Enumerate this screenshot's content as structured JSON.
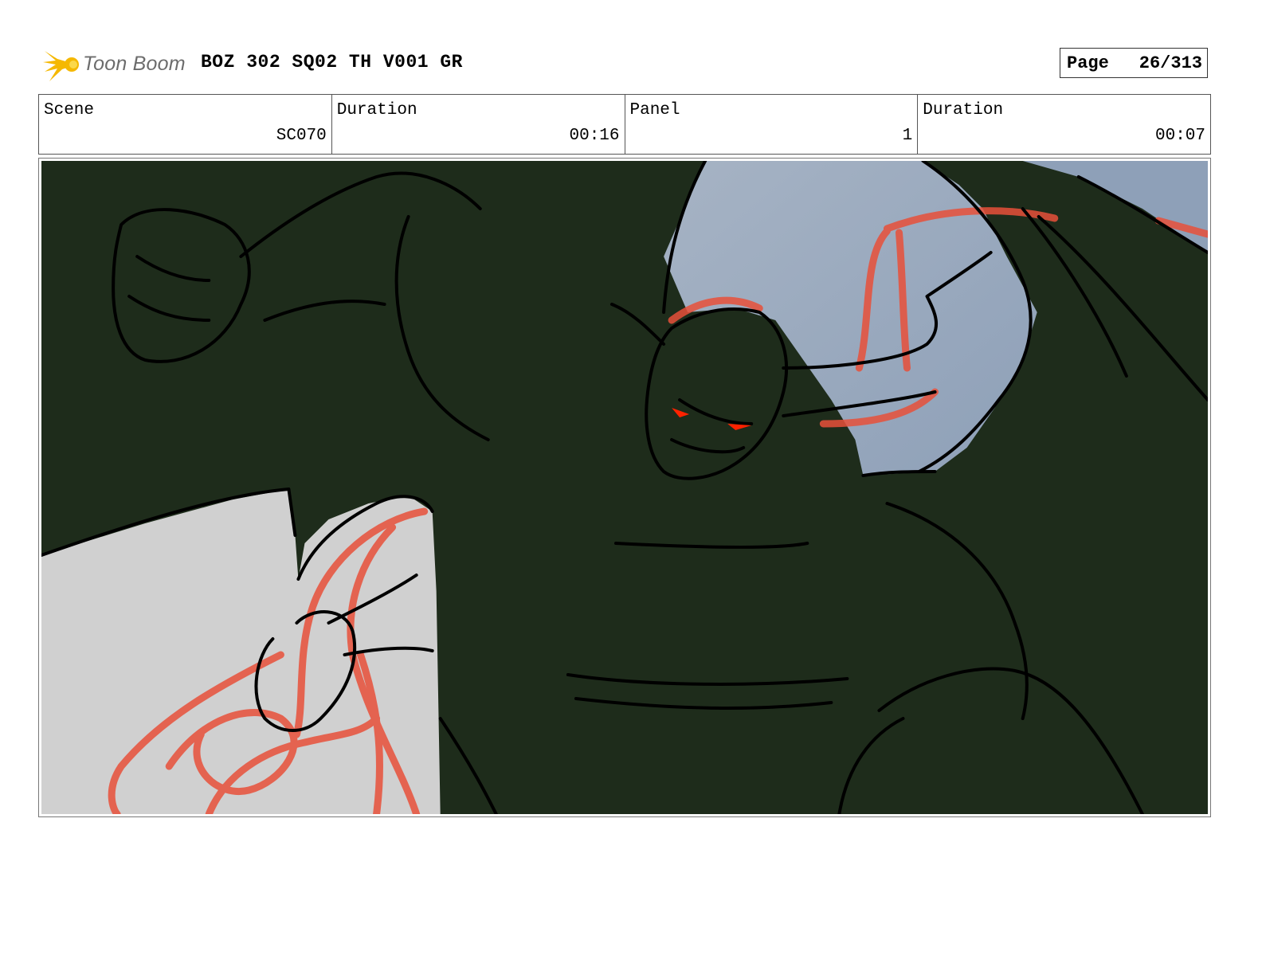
{
  "header": {
    "logo_text": "Toon Boom",
    "title": "BOZ 302 SQ02 TH V001 GR",
    "page_label": "Page",
    "page_value": "26/313"
  },
  "info": [
    {
      "label": "Scene",
      "value": "SC070"
    },
    {
      "label": "Duration",
      "value": "00:16"
    },
    {
      "label": "Panel",
      "value": "1"
    },
    {
      "label": "Duration",
      "value": "00:07"
    }
  ],
  "colors": {
    "demon": "#1e2c1b",
    "sky": "#9aaabe",
    "wall": "#d0d0d0",
    "red_sketch": "#e8503a",
    "eyes": "#ff2200",
    "logo_yellow": "#f5b800"
  }
}
